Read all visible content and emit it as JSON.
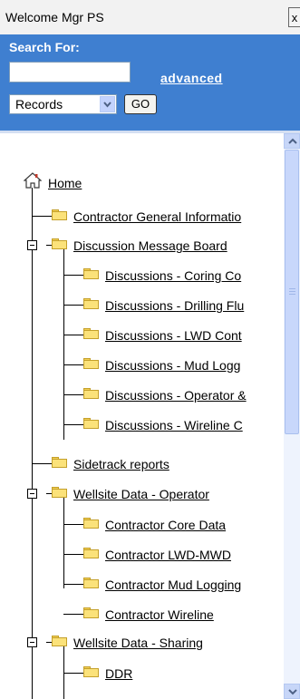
{
  "header": {
    "welcome_text": "Welcome Mgr PS",
    "close_label": "x"
  },
  "search": {
    "label": "Search For:",
    "input_value": "",
    "advanced_label": "advanced",
    "scope_selected": "Records",
    "go_label": "GO"
  },
  "tree": {
    "home": "Home",
    "items": [
      {
        "label": "Contractor General Informatio",
        "icon": "folder-icon"
      },
      {
        "label": "Discussion Message Board",
        "icon": "folder-icon"
      },
      {
        "label": "Discussions - Coring Co",
        "icon": "folder-icon"
      },
      {
        "label": "Discussions - Drilling Flu",
        "icon": "folder-icon"
      },
      {
        "label": "Discussions - LWD Cont",
        "icon": "folder-icon"
      },
      {
        "label": "Discussions - Mud Logg",
        "icon": "folder-icon"
      },
      {
        "label": "Discussions - Operator &",
        "icon": "folder-icon"
      },
      {
        "label": "Discussions - Wireline C",
        "icon": "folder-icon"
      },
      {
        "label": "Sidetrack reports",
        "icon": "folder-icon"
      },
      {
        "label": "Wellsite Data - Operator",
        "icon": "folder-icon"
      },
      {
        "label": "Contractor Core Data",
        "icon": "folder-icon"
      },
      {
        "label": "Contractor LWD-MWD",
        "icon": "folder-icon"
      },
      {
        "label": "Contractor Mud Logging",
        "icon": "folder-icon"
      },
      {
        "label": "Contractor Wireline",
        "icon": "folder-icon"
      },
      {
        "label": "Wellsite Data - Sharing",
        "icon": "folder-icon"
      },
      {
        "label": "DDR",
        "icon": "folder-icon"
      }
    ]
  }
}
